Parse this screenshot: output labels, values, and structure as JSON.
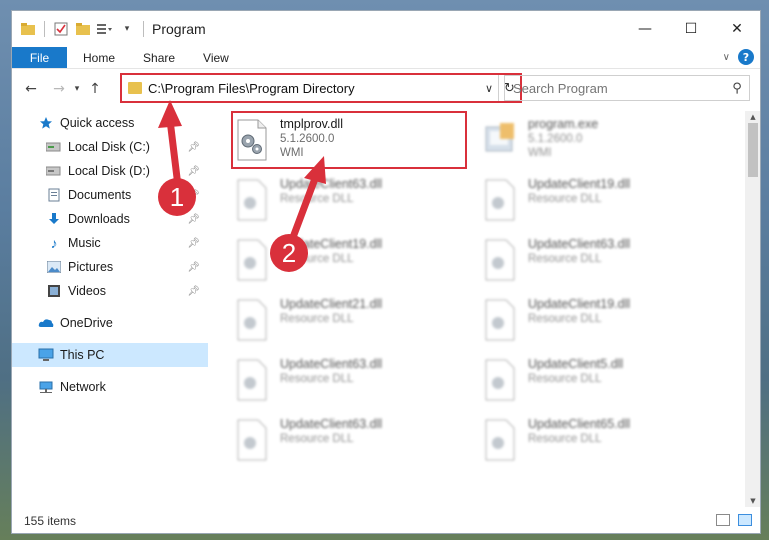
{
  "window": {
    "title": "Program",
    "controls": {
      "minimize": "—",
      "maximize": "☐",
      "close": "✕"
    }
  },
  "ribbon": {
    "file_label": "File",
    "tabs": [
      "Home",
      "Share",
      "View"
    ],
    "help": "?"
  },
  "nav": {
    "address_path": "C:\\Program Files\\Program Directory",
    "search_placeholder": "Search Program"
  },
  "sidebar": {
    "items": [
      {
        "label": "Quick access",
        "icon": "star-icon",
        "pinned": false,
        "selected": false,
        "indent": 1
      },
      {
        "label": "Local Disk (C:)",
        "icon": "drive-icon",
        "pinned": true,
        "selected": false,
        "indent": 2
      },
      {
        "label": "Local Disk (D:)",
        "icon": "drive-icon",
        "pinned": true,
        "selected": false,
        "indent": 2
      },
      {
        "label": "Documents",
        "icon": "documents-icon",
        "pinned": true,
        "selected": false,
        "indent": 2
      },
      {
        "label": "Downloads",
        "icon": "download-icon",
        "pinned": true,
        "selected": false,
        "indent": 2
      },
      {
        "label": "Music",
        "icon": "music-icon",
        "pinned": true,
        "selected": false,
        "indent": 2
      },
      {
        "label": "Pictures",
        "icon": "pictures-icon",
        "pinned": true,
        "selected": false,
        "indent": 2
      },
      {
        "label": "Videos",
        "icon": "videos-icon",
        "pinned": true,
        "selected": false,
        "indent": 2
      },
      {
        "label": "OneDrive",
        "icon": "cloud-icon",
        "pinned": false,
        "selected": false,
        "indent": 1
      },
      {
        "label": "This PC",
        "icon": "computer-icon",
        "pinned": false,
        "selected": true,
        "indent": 1
      },
      {
        "label": "Network",
        "icon": "network-icon",
        "pinned": false,
        "selected": false,
        "indent": 1
      }
    ]
  },
  "files": [
    {
      "name": "tmplprov.dll",
      "line2": "5.1.2600.0",
      "line3": "WMI",
      "icon": "dll-gear-icon",
      "blurred": false
    },
    {
      "name": "program.exe",
      "line2": "5.1.2600.0",
      "line3": "WMI",
      "icon": "exe-icon",
      "blurred": true
    },
    {
      "name": "UpdateClient63.dll",
      "line2": "Resource DLL",
      "line3": "",
      "icon": "dll-icon",
      "blurred": true
    },
    {
      "name": "UpdateClient19.dll",
      "line2": "Resource DLL",
      "line3": "",
      "icon": "dll-icon",
      "blurred": true
    },
    {
      "name": "UpdateClient19.dll",
      "line2": "Resource DLL",
      "line3": "",
      "icon": "dll-icon",
      "blurred": true
    },
    {
      "name": "UpdateClient63.dll",
      "line2": "Resource DLL",
      "line3": "",
      "icon": "dll-icon",
      "blurred": true
    },
    {
      "name": "UpdateClient21.dll",
      "line2": "Resource DLL",
      "line3": "",
      "icon": "dll-icon",
      "blurred": true
    },
    {
      "name": "UpdateClient19.dll",
      "line2": "Resource DLL",
      "line3": "",
      "icon": "dll-icon",
      "blurred": true
    },
    {
      "name": "UpdateClient63.dll",
      "line2": "Resource DLL",
      "line3": "",
      "icon": "dll-icon",
      "blurred": true
    },
    {
      "name": "UpdateClient5.dll",
      "line2": "Resource DLL",
      "line3": "",
      "icon": "dll-icon",
      "blurred": true
    },
    {
      "name": "UpdateClient63.dll",
      "line2": "Resource DLL",
      "line3": "",
      "icon": "dll-icon",
      "blurred": true
    },
    {
      "name": "UpdateClient65.dll",
      "line2": "Resource DLL",
      "line3": "",
      "icon": "dll-icon",
      "blurred": true
    }
  ],
  "status": {
    "count": "155 items"
  },
  "annotations": {
    "badge1": "1",
    "badge2": "2"
  },
  "colors": {
    "accent": "#1979ca",
    "highlight": "#d9303b",
    "selected": "#cce8ff"
  }
}
